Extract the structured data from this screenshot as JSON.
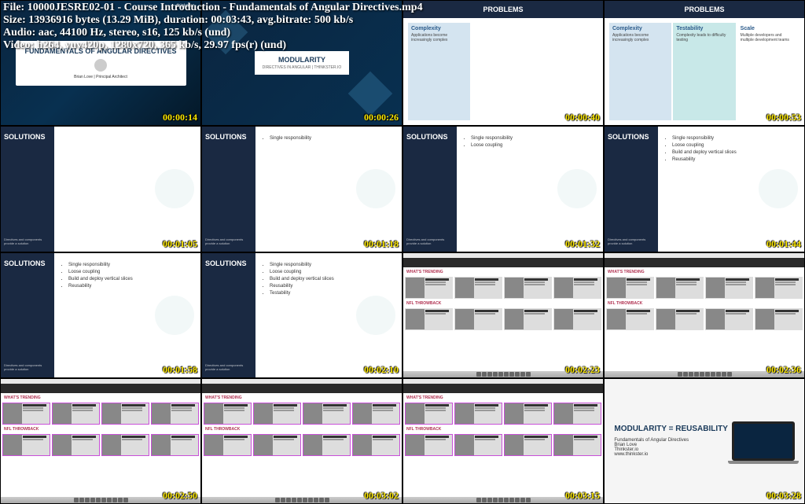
{
  "metadata": {
    "file_label": "File:",
    "file_value": "10000JESRE02-01 - Course Introduction - Fundamentals of Angular Directives.mp4",
    "size_label": "Size:",
    "size_value": "13936916 bytes (13.29 MiB), duration: 00:03:43, avg.bitrate: 500 kb/s",
    "audio_label": "Audio:",
    "audio_value": "aac, 44100 Hz, stereo, s16, 125 kb/s (und)",
    "video_label": "Video:",
    "video_value": "h264, yuv420p, 1280x720, 365 kb/s, 29.97 fps(r) (und)"
  },
  "slides": {
    "title_slide": {
      "logo": "thinkster",
      "heading": "FUNDAMENTALS OF ANGULAR DIRECTIVES",
      "author": "Brian Love | Principal Architect"
    },
    "modularity": {
      "heading": "MODULARITY",
      "sub": "DIRECTIVES IN ANGULAR | THINKSTER.IO"
    },
    "problems_header": "PROBLEMS",
    "problems": {
      "complexity_title": "Complexity",
      "complexity_text": "Applications become increasingly complex",
      "testability_title": "Testability",
      "testability_text": "Complexity leads to difficulty testing",
      "scale_title": "Scale",
      "scale_text": "Multiple developers and multiple development teams"
    },
    "solutions_header": "SOLUTIONS",
    "solutions_sub": "Directives and components provide a solution",
    "solutions_items": [
      "Single responsibility",
      "Loose coupling",
      "Build and deploy vertical slices",
      "Reusability",
      "Testability"
    ],
    "browser": {
      "section1": "WHAT'S TRENDING",
      "section2": "NFL THROWBACK"
    },
    "laptop": {
      "title": "MODULARITY = REUSABILITY",
      "line1": "Fundamentals of Angular Directives",
      "line2": "Brian Love",
      "line3": "Thinkster.io",
      "line4": "www.thinkster.io"
    }
  },
  "timestamps": [
    "00:00:14",
    "00:00:26",
    "00:00:40",
    "00:00:53",
    "00:01:05",
    "00:01:18",
    "00:01:32",
    "00:01:44",
    "00:01:58",
    "00:02:10",
    "00:02:23",
    "00:02:36",
    "00:02:50",
    "00:03:02",
    "00:03:15",
    "00:03:28"
  ]
}
